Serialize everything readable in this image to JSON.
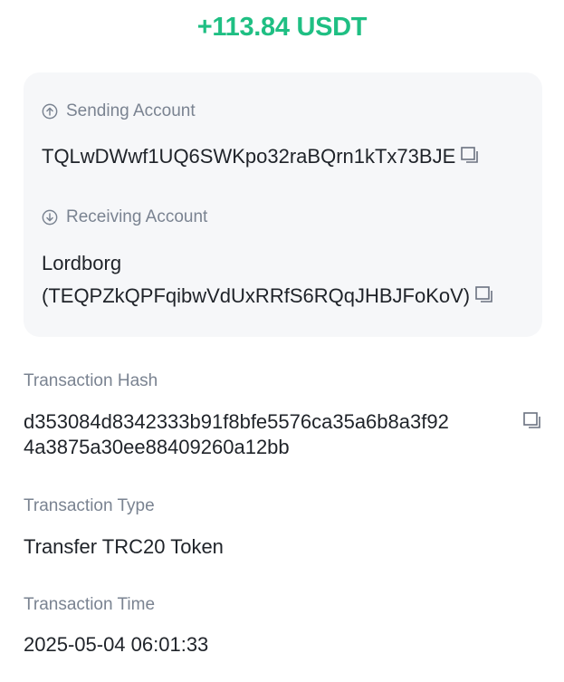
{
  "header": {
    "amount": "+113.84 USDT"
  },
  "colors": {
    "amount_green": "#1fbf83",
    "card_bg": "#f6f7f9",
    "label_gray": "#7a8391",
    "text_dark": "#1f2329"
  },
  "sending": {
    "icon": "arrow-up-circle-icon",
    "label": "Sending Account",
    "address": "TQLwDWwf1UQ6SWKpo32raBQrn1kTx73BJE"
  },
  "receiving": {
    "icon": "arrow-down-circle-icon",
    "label": "Receiving Account",
    "name": "Lordborg",
    "address": "(TEQPZkQPFqibwVdUxRRfS6RQqJHBJFoKoV)"
  },
  "hash": {
    "label": "Transaction Hash",
    "line1": "d353084d8342333b91f8bfe5576ca35a6b8a3f92",
    "line2": "4a3875a30ee88409260a12bb"
  },
  "type": {
    "label": "Transaction Type",
    "value": "Transfer TRC20 Token"
  },
  "time": {
    "label": "Transaction Time",
    "value": "2025-05-04 06:01:33"
  }
}
